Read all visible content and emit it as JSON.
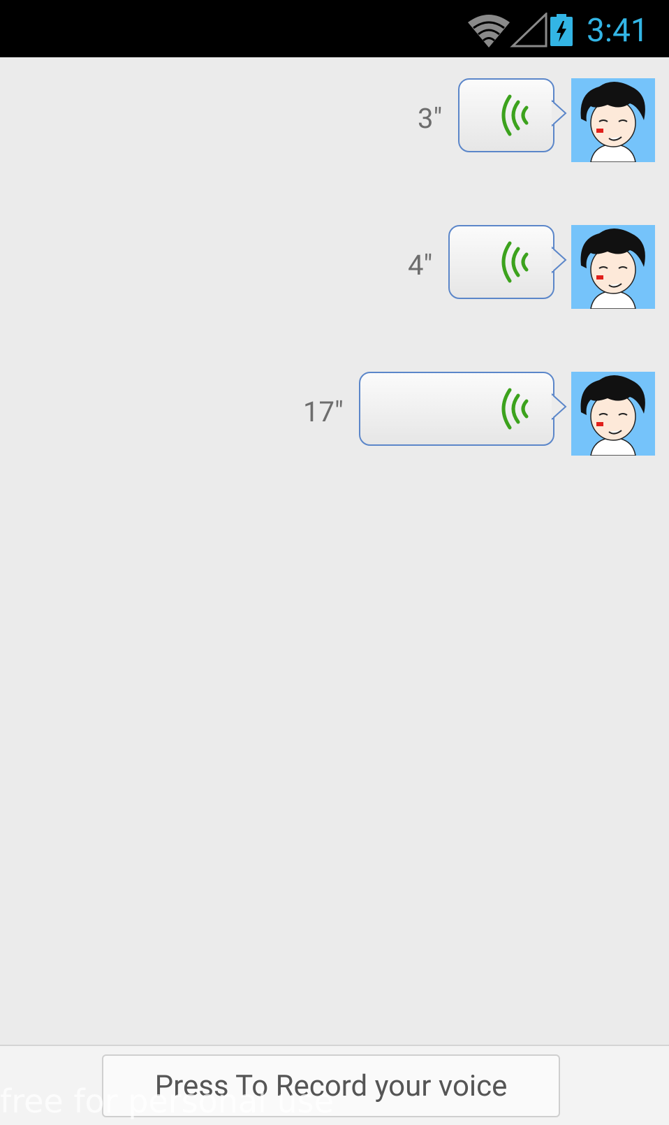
{
  "status_bar": {
    "time": "3:41",
    "icons": [
      "wifi-icon",
      "cell-signal-icon",
      "battery-charging-icon"
    ],
    "time_color": "#33b5e5"
  },
  "messages": [
    {
      "duration": "3\"",
      "type": "voice"
    },
    {
      "duration": "4\"",
      "type": "voice"
    },
    {
      "duration": "17\"",
      "type": "voice"
    }
  ],
  "record_button": {
    "label": "Press To Record your voice"
  },
  "watermark": "free for personal use",
  "colors": {
    "background": "#ebebeb",
    "bubble_border": "#5b86c9",
    "voice_wave": "#3ca21d",
    "avatar_background": "#75c3fa"
  }
}
